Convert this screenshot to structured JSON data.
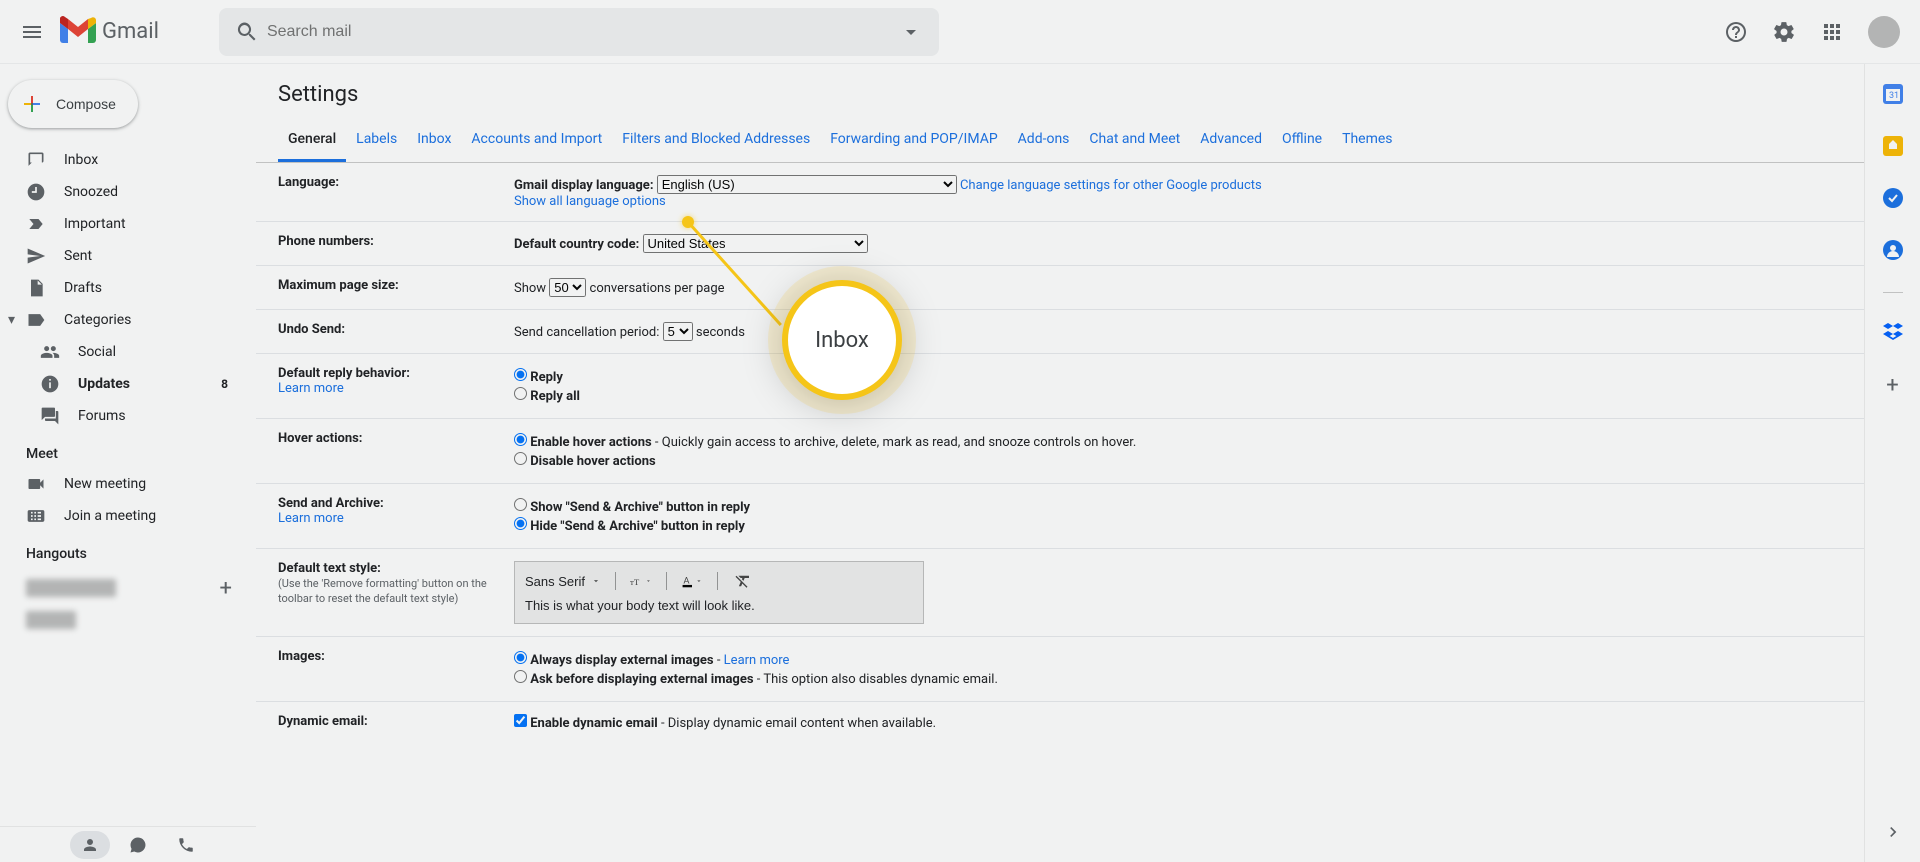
{
  "header": {
    "logo_text": "Gmail",
    "search_placeholder": "Search mail"
  },
  "compose_label": "Compose",
  "nav": {
    "inbox": "Inbox",
    "snoozed": "Snoozed",
    "important": "Important",
    "sent": "Sent",
    "drafts": "Drafts",
    "categories": "Categories",
    "social": "Social",
    "updates": "Updates",
    "updates_count": "8",
    "forums": "Forums"
  },
  "meet": {
    "title": "Meet",
    "new_meeting": "New meeting",
    "join_meeting": "Join a meeting"
  },
  "hangouts": {
    "title": "Hangouts"
  },
  "settings": {
    "title": "Settings",
    "tabs": {
      "general": "General",
      "labels": "Labels",
      "inbox": "Inbox",
      "accounts": "Accounts and Import",
      "filters": "Filters and Blocked Addresses",
      "forwarding": "Forwarding and POP/IMAP",
      "addons": "Add-ons",
      "chat": "Chat and Meet",
      "advanced": "Advanced",
      "offline": "Offline",
      "themes": "Themes"
    }
  },
  "rows": {
    "language": {
      "label": "Language:",
      "display_label": "Gmail display language:",
      "selected": "English (US)",
      "change_link": "Change language settings for other Google products",
      "show_all": "Show all language options"
    },
    "phone": {
      "label": "Phone numbers:",
      "country_label": "Default country code:",
      "selected": "United States"
    },
    "pagesize": {
      "label": "Maximum page size:",
      "show_prefix": "Show",
      "value": "50",
      "suffix": "conversations per page"
    },
    "undo": {
      "label": "Undo Send:",
      "prefix": "Send cancellation period:",
      "value": "5",
      "suffix": "seconds"
    },
    "reply": {
      "label": "Default reply behavior:",
      "learn": "Learn more",
      "reply": "Reply",
      "reply_all": "Reply all"
    },
    "hover": {
      "label": "Hover actions:",
      "enable_bold": "Enable hover actions",
      "enable_desc": " - Quickly gain access to archive, delete, mark as read, and snooze controls on hover.",
      "disable": "Disable hover actions"
    },
    "archive": {
      "label": "Send and Archive:",
      "learn": "Learn more",
      "show": "Show \"Send & Archive\" button in reply",
      "hide": "Hide \"Send & Archive\" button in reply"
    },
    "textstyle": {
      "label": "Default text style:",
      "sub": "(Use the 'Remove formatting' button on the toolbar to reset the default text style)",
      "font": "Sans Serif",
      "preview": "This is what your body text will look like."
    },
    "images": {
      "label": "Images:",
      "always": "Always display external images",
      "learn": "Learn more",
      "ask": "Ask before displaying external images",
      "ask_desc": " - This option also disables dynamic email."
    },
    "dynamic": {
      "label": "Dynamic email:",
      "enable": "Enable dynamic email",
      "desc": " - Display dynamic email content when available."
    }
  },
  "callout": {
    "text": "Inbox"
  }
}
